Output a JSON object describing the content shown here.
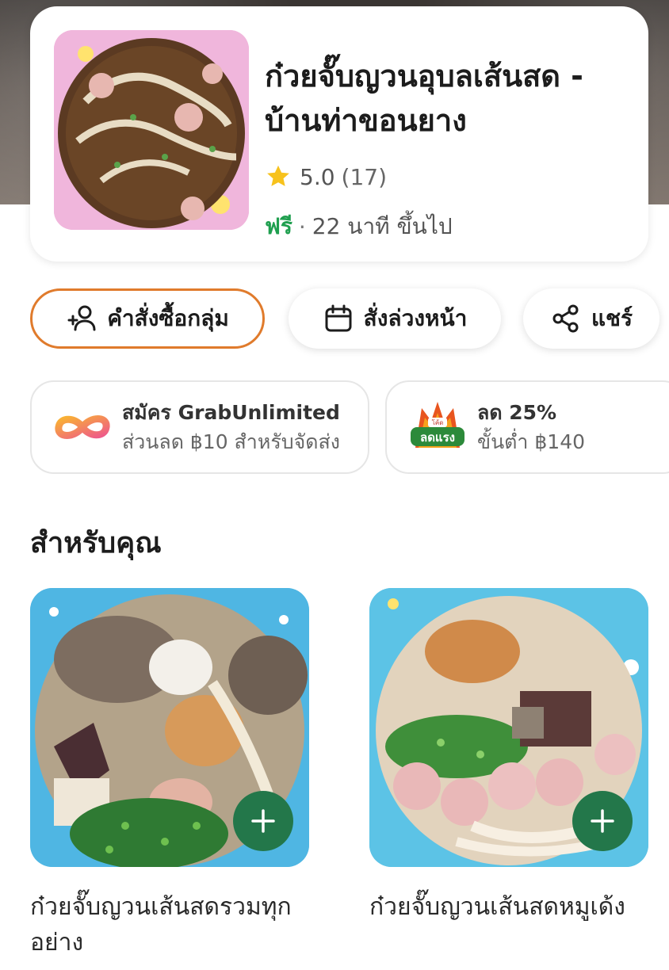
{
  "store": {
    "name": "ก๋วยจั๊บญวนอุบลเส้นสด - บ้านท่าขอนยาง",
    "rating": "5.0",
    "rating_count": "(17)",
    "delivery_fee": "ฟรี",
    "separator": "·",
    "delivery_time": "22 นาที ขึ้นไป",
    "icons": {
      "rating": "star-icon"
    }
  },
  "actions": {
    "group_order": "คำสั่งซื้อกลุ่ม",
    "schedule": "สั่งล่วงหน้า",
    "share": "แชร์",
    "icons": {
      "group_order": "add-group-icon",
      "schedule": "calendar-icon",
      "share": "share-icon"
    }
  },
  "promos": [
    {
      "title": "สมัคร GrabUnlimited",
      "subtitle": "ส่วนลด ฿10 สำหรับจัดส่ง",
      "icon": "grab-unlimited-logo"
    },
    {
      "title": "ลด 25%",
      "subtitle": "ขั้นต่ำ ฿140",
      "icon": "promo-code-logo",
      "logo_top_text": "โค้ด",
      "logo_main_text": "ลดแรง"
    }
  ],
  "section": {
    "title": "สำหรับคุณ"
  },
  "items": [
    {
      "name": "ก๋วยจั๊บญวนเส้นสดรวมทุกอย่าง",
      "add_icon": "plus-icon"
    },
    {
      "name": "ก๋วยจั๊บญวนเส้นสดหมูเด้ง",
      "add_icon": "plus-icon"
    }
  ],
  "colors": {
    "accent_green": "#1f9f4f",
    "add_button_green": "#23774a",
    "group_order_border": "#e07b2c",
    "star_yellow": "#f7c21c"
  }
}
